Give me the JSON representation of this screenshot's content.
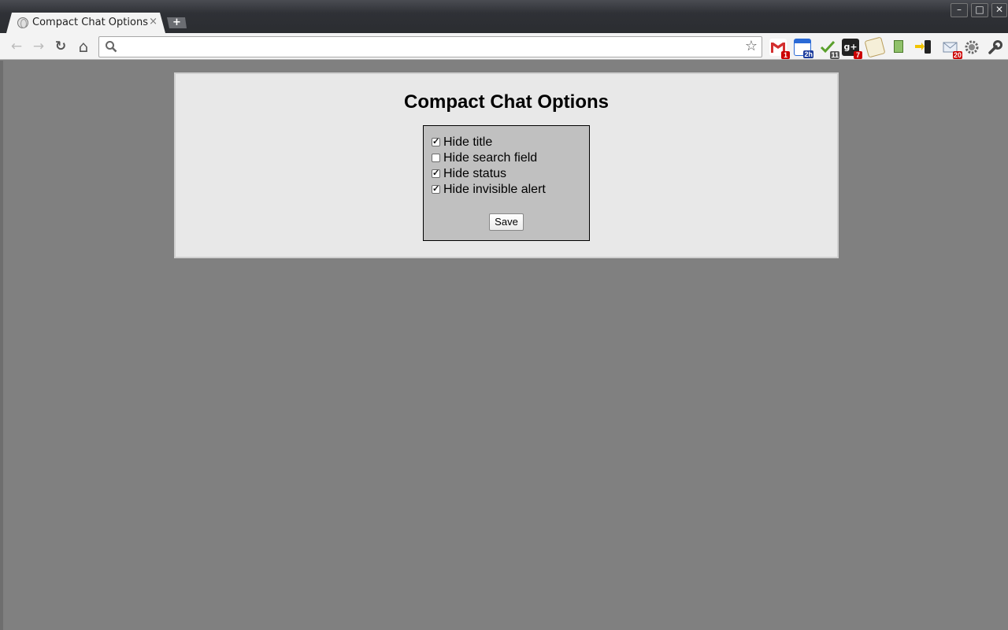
{
  "window": {
    "minimize_icon": "minimize-icon",
    "maximize_icon": "maximize-icon",
    "close_icon": "close-icon",
    "minimize_glyph": "–",
    "maximize_glyph": "□",
    "close_glyph": "✕"
  },
  "tabs": [
    {
      "title": "Compact Chat Options",
      "close_glyph": "×",
      "active": true
    }
  ],
  "new_tab_glyph": "+",
  "toolbar": {
    "back_glyph": "←",
    "forward_glyph": "→",
    "reload_glyph": "↻",
    "home_glyph": "⌂",
    "wrench_glyph": "🔧",
    "address_value": "",
    "star_glyph": "☆"
  },
  "extensions": [
    {
      "name": "gmail-checker",
      "badge": "1"
    },
    {
      "name": "calendar",
      "badge": "2h"
    },
    {
      "name": "tasks",
      "badge": "11"
    },
    {
      "name": "google-plus",
      "badge": "7"
    },
    {
      "name": "notepad",
      "badge": ""
    },
    {
      "name": "green-extension",
      "badge": ""
    },
    {
      "name": "phone-sender",
      "badge": ""
    },
    {
      "name": "mail-notifier",
      "badge": "20"
    },
    {
      "name": "settings-gear",
      "badge": ""
    }
  ],
  "page": {
    "title": "Compact Chat Options",
    "options": [
      {
        "label": "Hide title",
        "checked": true
      },
      {
        "label": "Hide search field",
        "checked": false
      },
      {
        "label": "Hide status",
        "checked": true
      },
      {
        "label": "Hide invisible alert",
        "checked": true
      }
    ],
    "save_label": "Save"
  },
  "colors": {
    "page_background": "#808080",
    "panel_background": "#e8e8e8",
    "options_background": "#c0c0c0"
  }
}
